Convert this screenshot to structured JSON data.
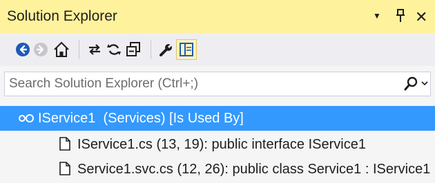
{
  "titlebar": {
    "title": "Solution Explorer",
    "dropdown_glyph": "▼",
    "pin_glyph": "ᵻ",
    "close_glyph": "✕"
  },
  "toolbar": {
    "buttons": [
      {
        "name": "back-icon",
        "enabled": true
      },
      {
        "name": "forward-icon",
        "enabled": false
      },
      {
        "name": "home-icon",
        "enabled": true
      },
      {
        "name": "sync-icon",
        "enabled": true
      },
      {
        "name": "refresh-icon",
        "enabled": true
      },
      {
        "name": "collapse-all-icon",
        "enabled": true
      },
      {
        "name": "properties-wrench-icon",
        "enabled": true
      },
      {
        "name": "preview-icon",
        "enabled": true,
        "active": true
      }
    ]
  },
  "search": {
    "placeholder": "Search Solution Explorer (Ctrl+;)"
  },
  "tree": {
    "root": {
      "icon": "infinity-link-icon",
      "label": "IService1  (Services) [Is Used By]",
      "selected": true
    },
    "children": [
      {
        "icon": "document-icon",
        "label": "IService1.cs (13, 19): public interface IService1"
      },
      {
        "icon": "document-icon",
        "label": "Service1.svc.cs (12, 26): public class Service1 : IService1"
      }
    ]
  },
  "colors": {
    "title_bg": "#fff29d",
    "toolbar_bg": "#eeeef2",
    "panel_bg": "#f5f5f5",
    "selection_bg": "#3399ff",
    "accent_blue": "#1e5ab4"
  }
}
